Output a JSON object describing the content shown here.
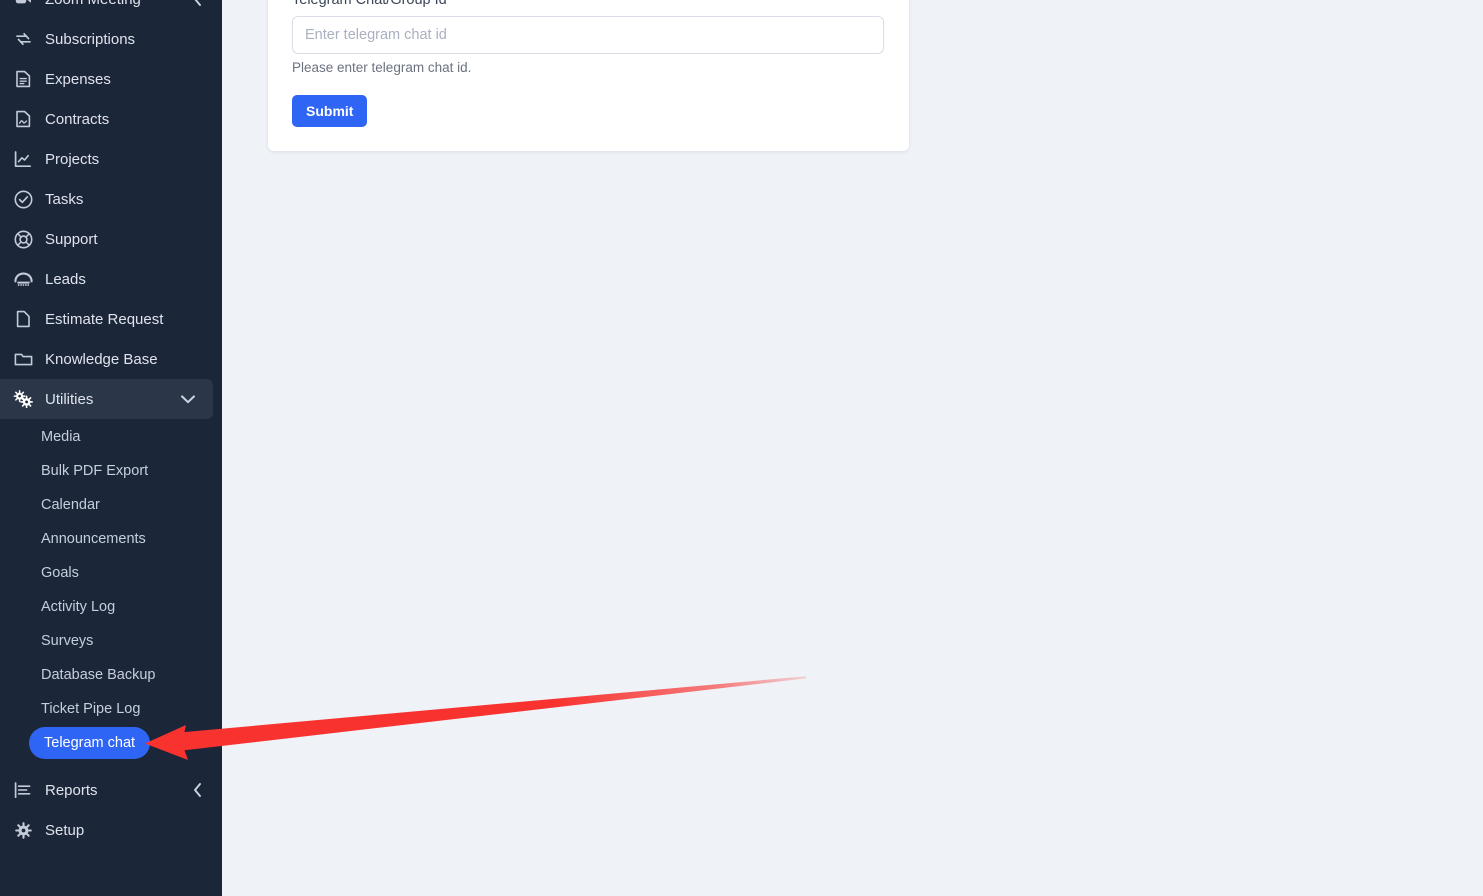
{
  "colors": {
    "sidebar_bg": "#1c2639",
    "sidebar_active_bg": "#2b3649",
    "accent_blue": "#2f65f5",
    "main_bg": "#eff2f7",
    "card_bg": "#ffffff",
    "annotation_red": "#f8322f"
  },
  "sidebar": {
    "items": [
      {
        "label": "Zoom Meeting",
        "icon": "video-camera-icon",
        "has_chevron": true,
        "chevron": "chevron-left-icon",
        "clipped_top": true
      },
      {
        "label": "Subscriptions",
        "icon": "refresh-cycle-icon",
        "has_chevron": false
      },
      {
        "label": "Expenses",
        "icon": "file-text-icon",
        "has_chevron": false
      },
      {
        "label": "Contracts",
        "icon": "file-signature-icon",
        "has_chevron": false
      },
      {
        "label": "Projects",
        "icon": "chart-line-icon",
        "has_chevron": false
      },
      {
        "label": "Tasks",
        "icon": "check-circle-icon",
        "has_chevron": false
      },
      {
        "label": "Support",
        "icon": "lifebuoy-icon",
        "has_chevron": false
      },
      {
        "label": "Leads",
        "icon": "telephone-icon",
        "has_chevron": false
      },
      {
        "label": "Estimate Request",
        "icon": "file-icon",
        "has_chevron": false
      },
      {
        "label": "Knowledge Base",
        "icon": "folder-icon",
        "has_chevron": false
      },
      {
        "label": "Utilities",
        "icon": "cogs-icon",
        "has_chevron": true,
        "chevron": "chevron-down-icon",
        "active": true
      }
    ],
    "utilities_submenu": [
      {
        "label": "Media",
        "selected": false
      },
      {
        "label": "Bulk PDF Export",
        "selected": false
      },
      {
        "label": "Calendar",
        "selected": false
      },
      {
        "label": "Announcements",
        "selected": false
      },
      {
        "label": "Goals",
        "selected": false
      },
      {
        "label": "Activity Log",
        "selected": false
      },
      {
        "label": "Surveys",
        "selected": false
      },
      {
        "label": "Database Backup",
        "selected": false
      },
      {
        "label": "Ticket Pipe Log",
        "selected": false
      },
      {
        "label": "Telegram chat",
        "selected": true
      }
    ],
    "items_after": [
      {
        "label": "Reports",
        "icon": "bar-chart-icon",
        "has_chevron": true,
        "chevron": "chevron-left-icon"
      },
      {
        "label": "Setup",
        "icon": "gear-icon",
        "has_chevron": false
      }
    ]
  },
  "form": {
    "field_label": "Telegram Chat/Group Id",
    "input_value": "",
    "input_placeholder": "Enter telegram chat id",
    "help_text": "Please enter telegram chat id.",
    "submit_label": "Submit"
  },
  "annotation": {
    "type": "arrow",
    "target": "Telegram chat",
    "color": "#f8322f"
  }
}
